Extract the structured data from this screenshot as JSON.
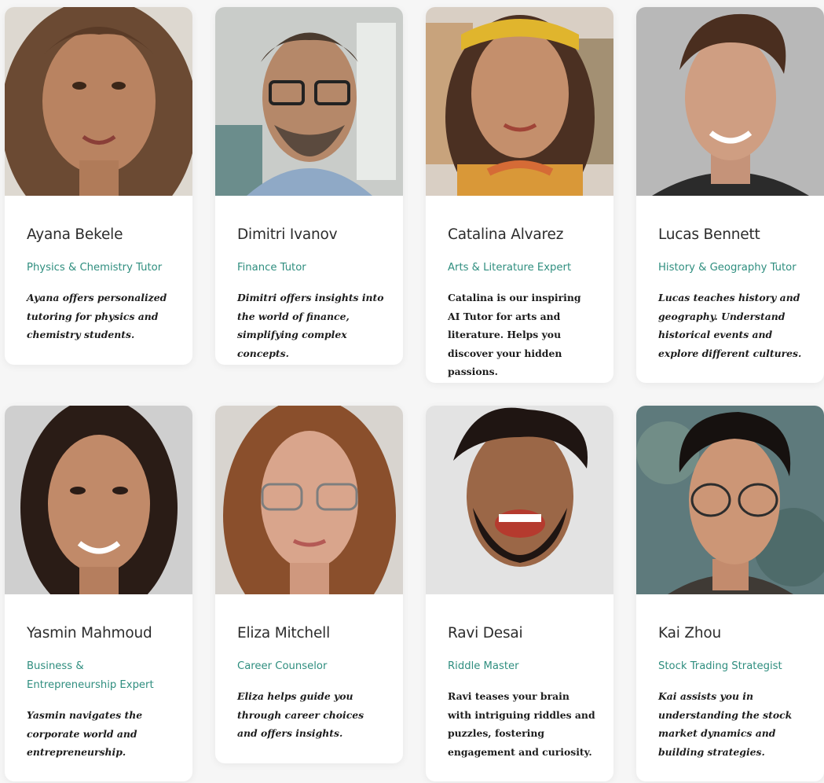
{
  "tutors": [
    {
      "name": "Ayana Bekele",
      "role": "Physics & Chemistry Tutor",
      "bio": "Ayana offers personalized tutoring for physics and chemistry students."
    },
    {
      "name": "Dimitri Ivanov",
      "role": "Finance Tutor",
      "bio": "Dimitri offers insights into the world of finance, simplifying complex concepts."
    },
    {
      "name": "Catalina Alvarez",
      "role": "Arts & Literature Expert",
      "bio": "Catalina is our inspiring AI Tutor for arts and literature. Helps you discover your hidden passions."
    },
    {
      "name": "Lucas Bennett",
      "role": "History & Geography Tutor",
      "bio": "Lucas teaches history and geography. Understand historical events and explore different cultures."
    },
    {
      "name": "Yasmin Mahmoud",
      "role": "Business & Entrepreneurship Expert",
      "bio": "Yasmin navigates the corporate world and entrepreneurship."
    },
    {
      "name": "Eliza Mitchell",
      "role": "Career Counselor",
      "bio": "Eliza helps guide you through career choices and offers insights."
    },
    {
      "name": "Ravi Desai",
      "role": "Riddle Master",
      "bio": "Ravi teases your brain with intriguing riddles and puzzles, fostering engagement and curiosity."
    },
    {
      "name": "Kai Zhou",
      "role": "Stock Trading Strategist",
      "bio": "Kai assists you in understanding the stock market dynamics and building strategies."
    }
  ],
  "colors": {
    "role_accent": "#2f8e7f",
    "name_text": "#2c2c2c",
    "bio_text": "#1c1c1c",
    "page_bg": "#f6f6f6"
  }
}
